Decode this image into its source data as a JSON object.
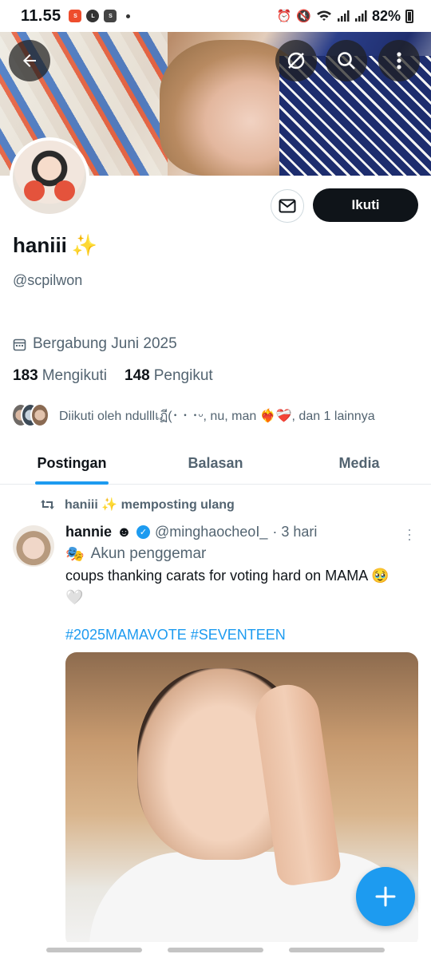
{
  "status_bar": {
    "time": "11.55",
    "battery": "82%",
    "notification_icons": [
      "shopeepay-icon",
      "line-icon",
      "shopee-icon"
    ]
  },
  "header": {
    "back_icon": "arrow-left-icon",
    "icons": [
      "grok-icon",
      "search-icon",
      "more-vertical-icon"
    ]
  },
  "profile": {
    "display_name": "haniii",
    "name_emoji": "✨",
    "handle": "@scpilwon",
    "joined": "Bergabung Juni 2025",
    "following_count": "183",
    "following_label": "Mengikuti",
    "followers_count": "148",
    "followers_label": "Pengikut",
    "followed_by": "Diikuti oleh ndulllเฏี(･ ･ ･ᵕ, nu, man ❤️‍🔥❤️‍🩹, dan 1 lainnya",
    "follow_button": "Ikuti",
    "message_icon": "envelope-icon"
  },
  "tabs": [
    {
      "label": "Postingan",
      "active": true
    },
    {
      "label": "Balasan",
      "active": false
    },
    {
      "label": "Media",
      "active": false
    }
  ],
  "post": {
    "repost_text": "haniii ✨ memposting ulang",
    "author_name": "hannie",
    "author_badge": "☻",
    "author_handle": "@minghaocheoI_",
    "time": "· 3 hari",
    "fan_label": "Akun penggemar",
    "fan_icon": "🎭",
    "text": "coups thanking carats for voting hard on MAMA 🥹",
    "text_line2": "🤍",
    "hashtags": "#2025MAMAVOTE #SEVENTEEN"
  },
  "fab": {
    "icon": "plus-icon"
  },
  "colors": {
    "accent": "#1d9bf0",
    "text": "#0f1419",
    "muted": "#536471",
    "button": "#0f1419"
  }
}
